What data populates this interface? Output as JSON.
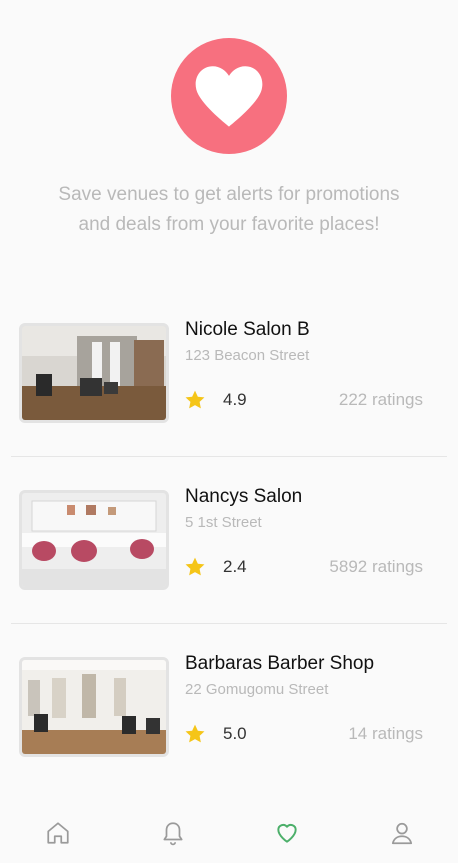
{
  "hero": {
    "icon": "heart-icon",
    "color": "#f7707f"
  },
  "intro_text": "Save venues to get alerts for promotions and deals from your favorite places!",
  "venues": [
    {
      "name": "Nicole Salon B",
      "address": "123 Beacon Street",
      "rating": "4.9",
      "ratings_count": "222 ratings",
      "image": "salon-interior-photo"
    },
    {
      "name": "Nancys Salon",
      "address": "5 1st Street",
      "rating": "2.4",
      "ratings_count": "5892 ratings",
      "image": "salon-interior-photo"
    },
    {
      "name": "Barbaras Barber Shop",
      "address": "22 Gomugomu Street",
      "rating": "5.0",
      "ratings_count": "14 ratings",
      "image": "barbershop-interior-photo"
    }
  ],
  "tabbar": {
    "items": [
      {
        "icon": "home-icon",
        "active": false
      },
      {
        "icon": "bell-icon",
        "active": false
      },
      {
        "icon": "heart-outline-icon",
        "active": true
      },
      {
        "icon": "user-icon",
        "active": false
      }
    ],
    "active_color": "#4caf6a",
    "inactive_color": "#9a9a9a"
  },
  "colors": {
    "star": "#f5c518",
    "accent": "#f7707f"
  }
}
